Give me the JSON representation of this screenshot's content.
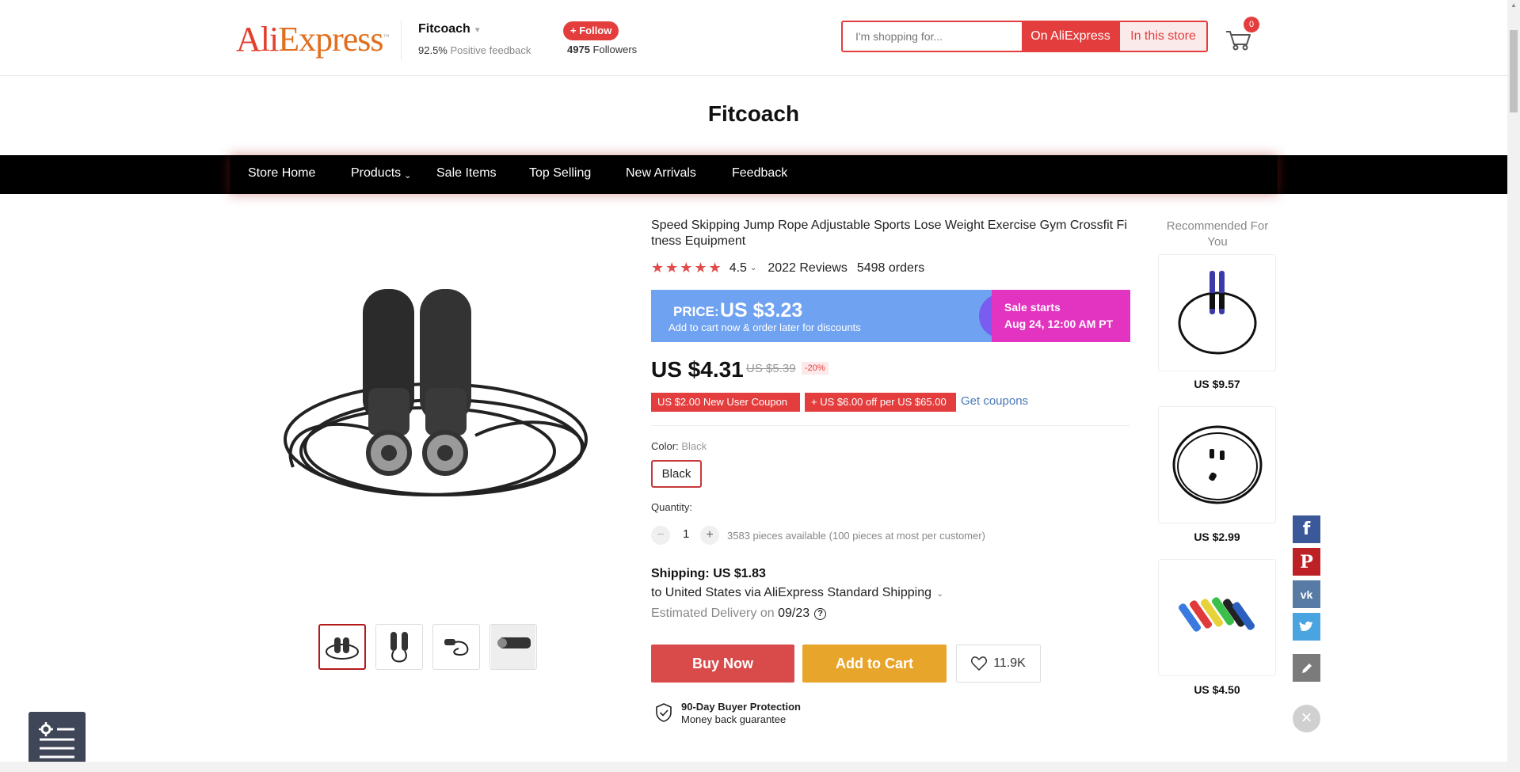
{
  "header": {
    "logo_text": "AliExpress",
    "logo_tm": "™",
    "store_name": "Fitcoach",
    "feedback_pct": "92.5%",
    "feedback_label": "Positive feedback",
    "follow_label": "+ Follow",
    "followers_count": "4975",
    "followers_label": "Followers",
    "search_placeholder": "I'm shopping for...",
    "search_on_ali": "On AliExpress",
    "search_in_store": "In this store",
    "cart_count": "0"
  },
  "store_title": "Fitcoach",
  "nav": {
    "items": [
      "Store Home",
      "Products",
      "Sale Items",
      "Top Selling",
      "New Arrivals",
      "Feedback"
    ]
  },
  "product": {
    "title": "Speed Skipping Jump Rope Adjustable Sports Lose Weight Exercise Gym Crossfit Fitness Equipment",
    "stars": "★★★★★",
    "rating": "4.5",
    "reviews": "2022 Reviews",
    "orders": "5498 orders",
    "banner_price_label": "PRICE:",
    "banner_price": "US $3.23",
    "banner_sub": "Add to cart now & order later for discounts",
    "sale_line1": "Sale starts",
    "sale_line2": "Aug 24, 12:00 AM PT",
    "current_price": "US $4.31",
    "old_price": "US $5.39",
    "discount": "-20%",
    "coupon1": "US $2.00 New User Coupon",
    "coupon2": "+ US $6.00 off per US $65.00",
    "get_coupons": "Get coupons",
    "color_label": "Color:",
    "color_value": "Black",
    "color_option": "Black",
    "quantity_label": "Quantity:",
    "quantity_value": "1",
    "availability": "3583 pieces available (100 pieces at most per customer)",
    "shipping": "Shipping: US $1.83",
    "shipping_to": "to United States via AliExpress Standard Shipping",
    "delivery_label": "Estimated Delivery on",
    "delivery_date": "09/23",
    "buy_now": "Buy Now",
    "add_to_cart": "Add to Cart",
    "wishlist_count": "11.9K",
    "protection_title": "90-Day Buyer Protection",
    "protection_sub": "Money back guarantee"
  },
  "recommended": {
    "title": "Recommended For You",
    "items": [
      {
        "price": "US $9.57"
      },
      {
        "price": "US $2.99"
      },
      {
        "price": "US $4.50"
      }
    ]
  },
  "social": [
    "facebook-icon",
    "pinterest-icon",
    "vk-icon",
    "twitter-icon",
    "edit-icon"
  ],
  "colors": {
    "accent": "#e43d3d",
    "banner_blue": "#6fa2f0",
    "sale_magenta": "#e234c0",
    "add_to_cart": "#e8a52c",
    "facebook": "#3b5998",
    "pinterest": "#bd2126",
    "vk": "#587ba5",
    "twitter": "#4aa4e0"
  }
}
